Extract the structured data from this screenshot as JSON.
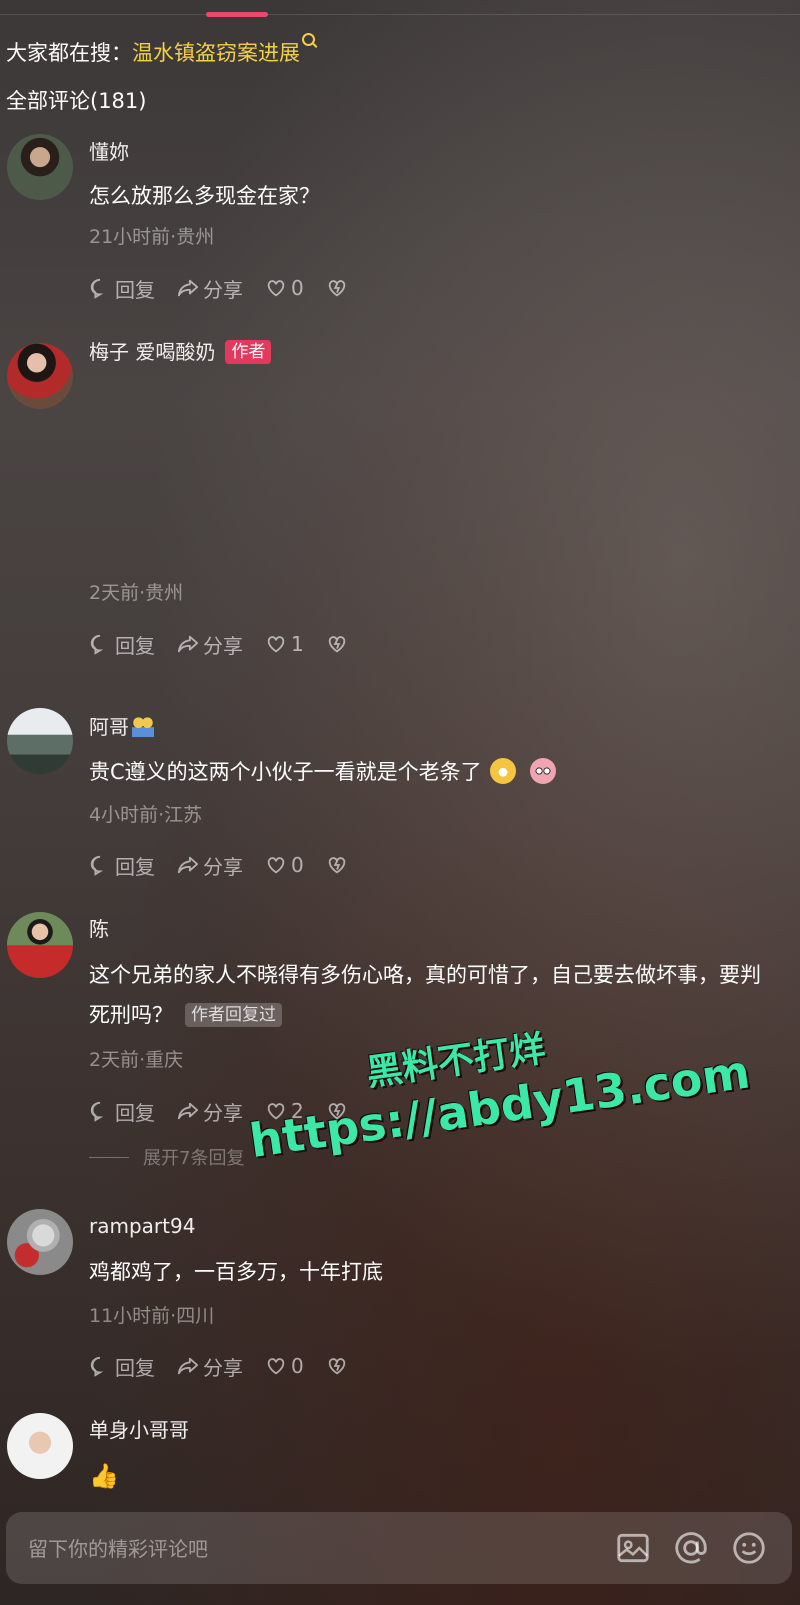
{
  "search": {
    "prefix": "大家都在搜：",
    "query": "温水镇盗窃案进展"
  },
  "comments_count_label": "全部评论(181)",
  "comments": [
    {
      "user": "懂妳",
      "text": "怎么放那么多现金在家？",
      "meta": "21小时前·贵州",
      "reply": "回复",
      "share": "分享",
      "likes": "0"
    },
    {
      "user": "梅子 爱喝酸奶",
      "author_tag": "作者",
      "text": "",
      "meta": "2天前·贵州",
      "reply": "回复",
      "share": "分享",
      "likes": "1"
    },
    {
      "user": "阿哥",
      "text": "贵C遵义的这两个小伙子一看就是个老条了",
      "meta": "4小时前·江苏",
      "reply": "回复",
      "share": "分享",
      "likes": "0"
    },
    {
      "user": "陈",
      "text": "这个兄弟的家人不晓得有多伤心咯，真的可惜了，自己要去做坏事，要判死刑吗？",
      "replied_tag": "作者回复过",
      "meta": "2天前·重庆",
      "reply": "回复",
      "share": "分享",
      "likes": "2",
      "expand": "展开7条回复"
    },
    {
      "user": "rampart94",
      "text": "鸡都鸡了，一百多万，十年打底",
      "meta": "11小时前·四川",
      "reply": "回复",
      "share": "分享",
      "likes": "0"
    },
    {
      "user": "单身小哥哥",
      "text": "",
      "emoji": "thumbs-up"
    }
  ],
  "watermark": {
    "line1": "黑料不打烊",
    "line2": "https://abdy13.com"
  },
  "input": {
    "placeholder": "留下你的精彩评论吧"
  },
  "icons": [
    "reply-icon",
    "share-icon",
    "like-icon",
    "dislike-icon",
    "image-icon",
    "at-icon",
    "emoji-icon",
    "search-icon"
  ],
  "colors": {
    "accent": "#e5385e",
    "search_query": "#f3d046",
    "watermark": "#3ce8a5"
  }
}
